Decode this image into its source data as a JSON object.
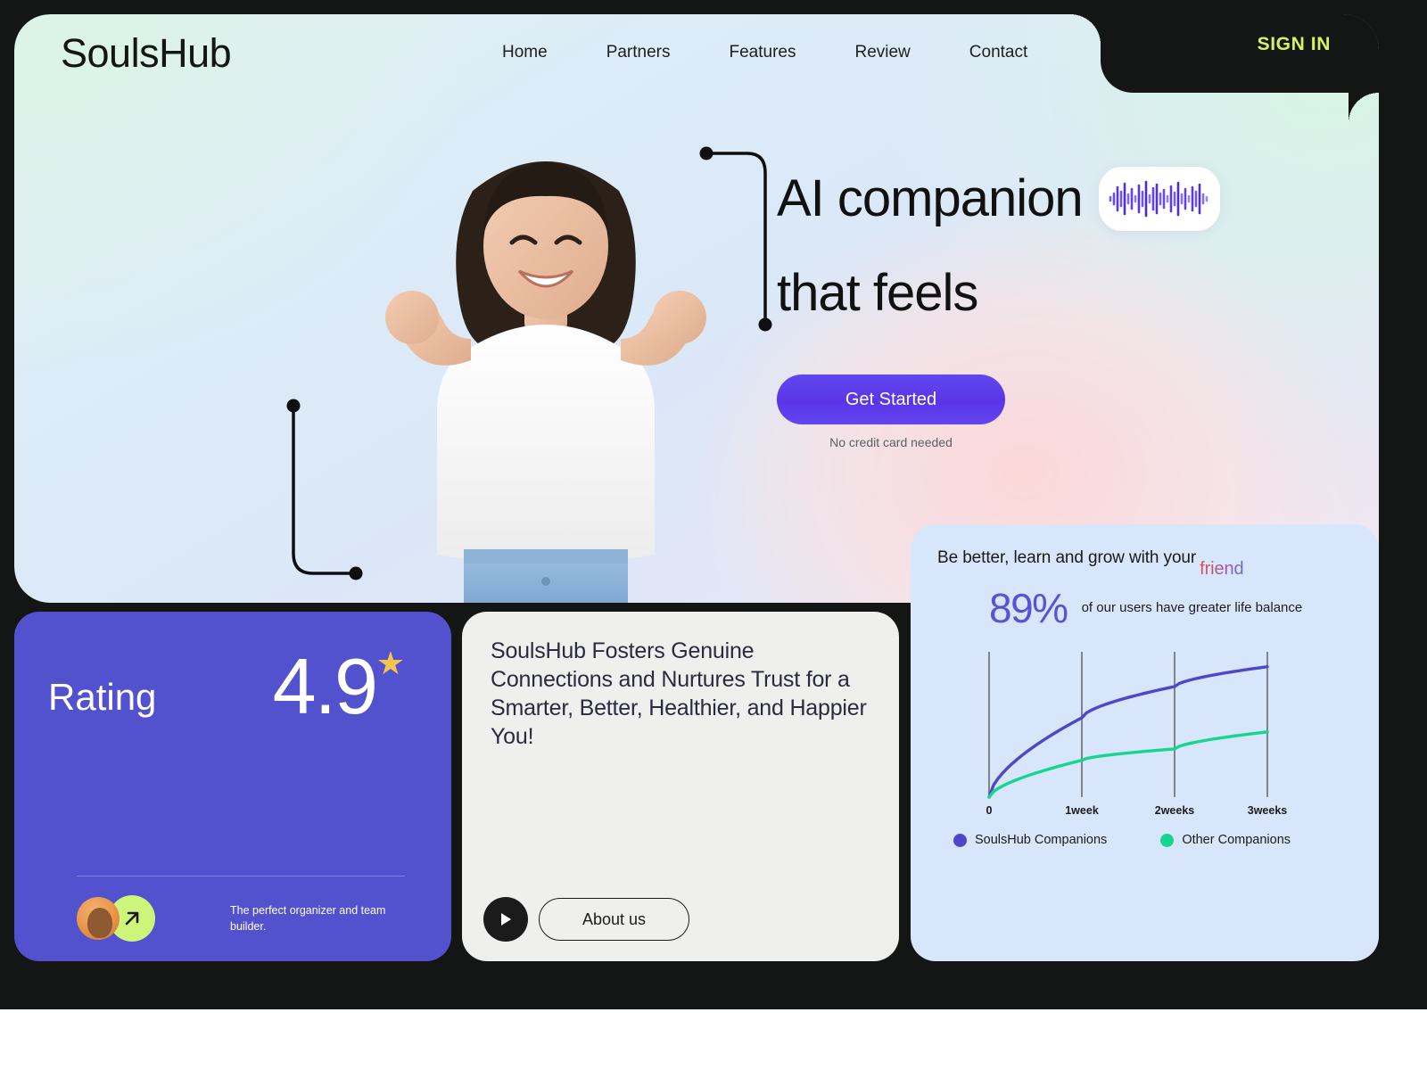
{
  "brand": {
    "logo": "SoulsHub",
    "accent": "#5352ce",
    "signin_color": "#d6f25c"
  },
  "nav": {
    "items": [
      {
        "label": "Home"
      },
      {
        "label": "Partners"
      },
      {
        "label": "Features"
      },
      {
        "label": "Review"
      },
      {
        "label": "Contact"
      }
    ],
    "signin_label": "SIGN IN"
  },
  "hero": {
    "headline_line1": "AI companion",
    "headline_line2": "that feels",
    "cta_label": "Get Started",
    "cta_note": "No credit card needed",
    "waveform_icon": "audio-waveform-icon"
  },
  "rating_card": {
    "label": "Rating",
    "value": "4.9",
    "star_icon": "star-icon",
    "arrow_icon": "arrow-up-right-icon",
    "avatar_icon": "user-avatar",
    "caption": "The perfect organizer and team builder."
  },
  "about_card": {
    "text": "SoulsHub Fosters Genuine Connections and Nurtures Trust for a Smarter, Better, Healthier, and Happier You!",
    "play_icon": "play-icon",
    "button_label": "About us"
  },
  "chart_card": {
    "title_prefix": "Be better, learn and grow with your",
    "title_highlight": "friend",
    "stat_value": "89%",
    "stat_desc": "of our users have greater life balance"
  },
  "chart_data": {
    "type": "line",
    "title": "Be better, learn and grow with your friend",
    "xlabel": "",
    "ylabel": "",
    "x": [
      0,
      1,
      2,
      3
    ],
    "categories": [
      "0",
      "1week",
      "2weeks",
      "3weeks"
    ],
    "series": [
      {
        "name": "SoulsHub Companions",
        "color": "#4f46c9",
        "values": [
          0,
          56,
          78,
          92
        ]
      },
      {
        "name": "Other Companions",
        "color": "#16d68f",
        "values": [
          0,
          26,
          34,
          46
        ]
      }
    ],
    "ylim": [
      0,
      100
    ],
    "grid": true,
    "legend_position": "bottom"
  }
}
